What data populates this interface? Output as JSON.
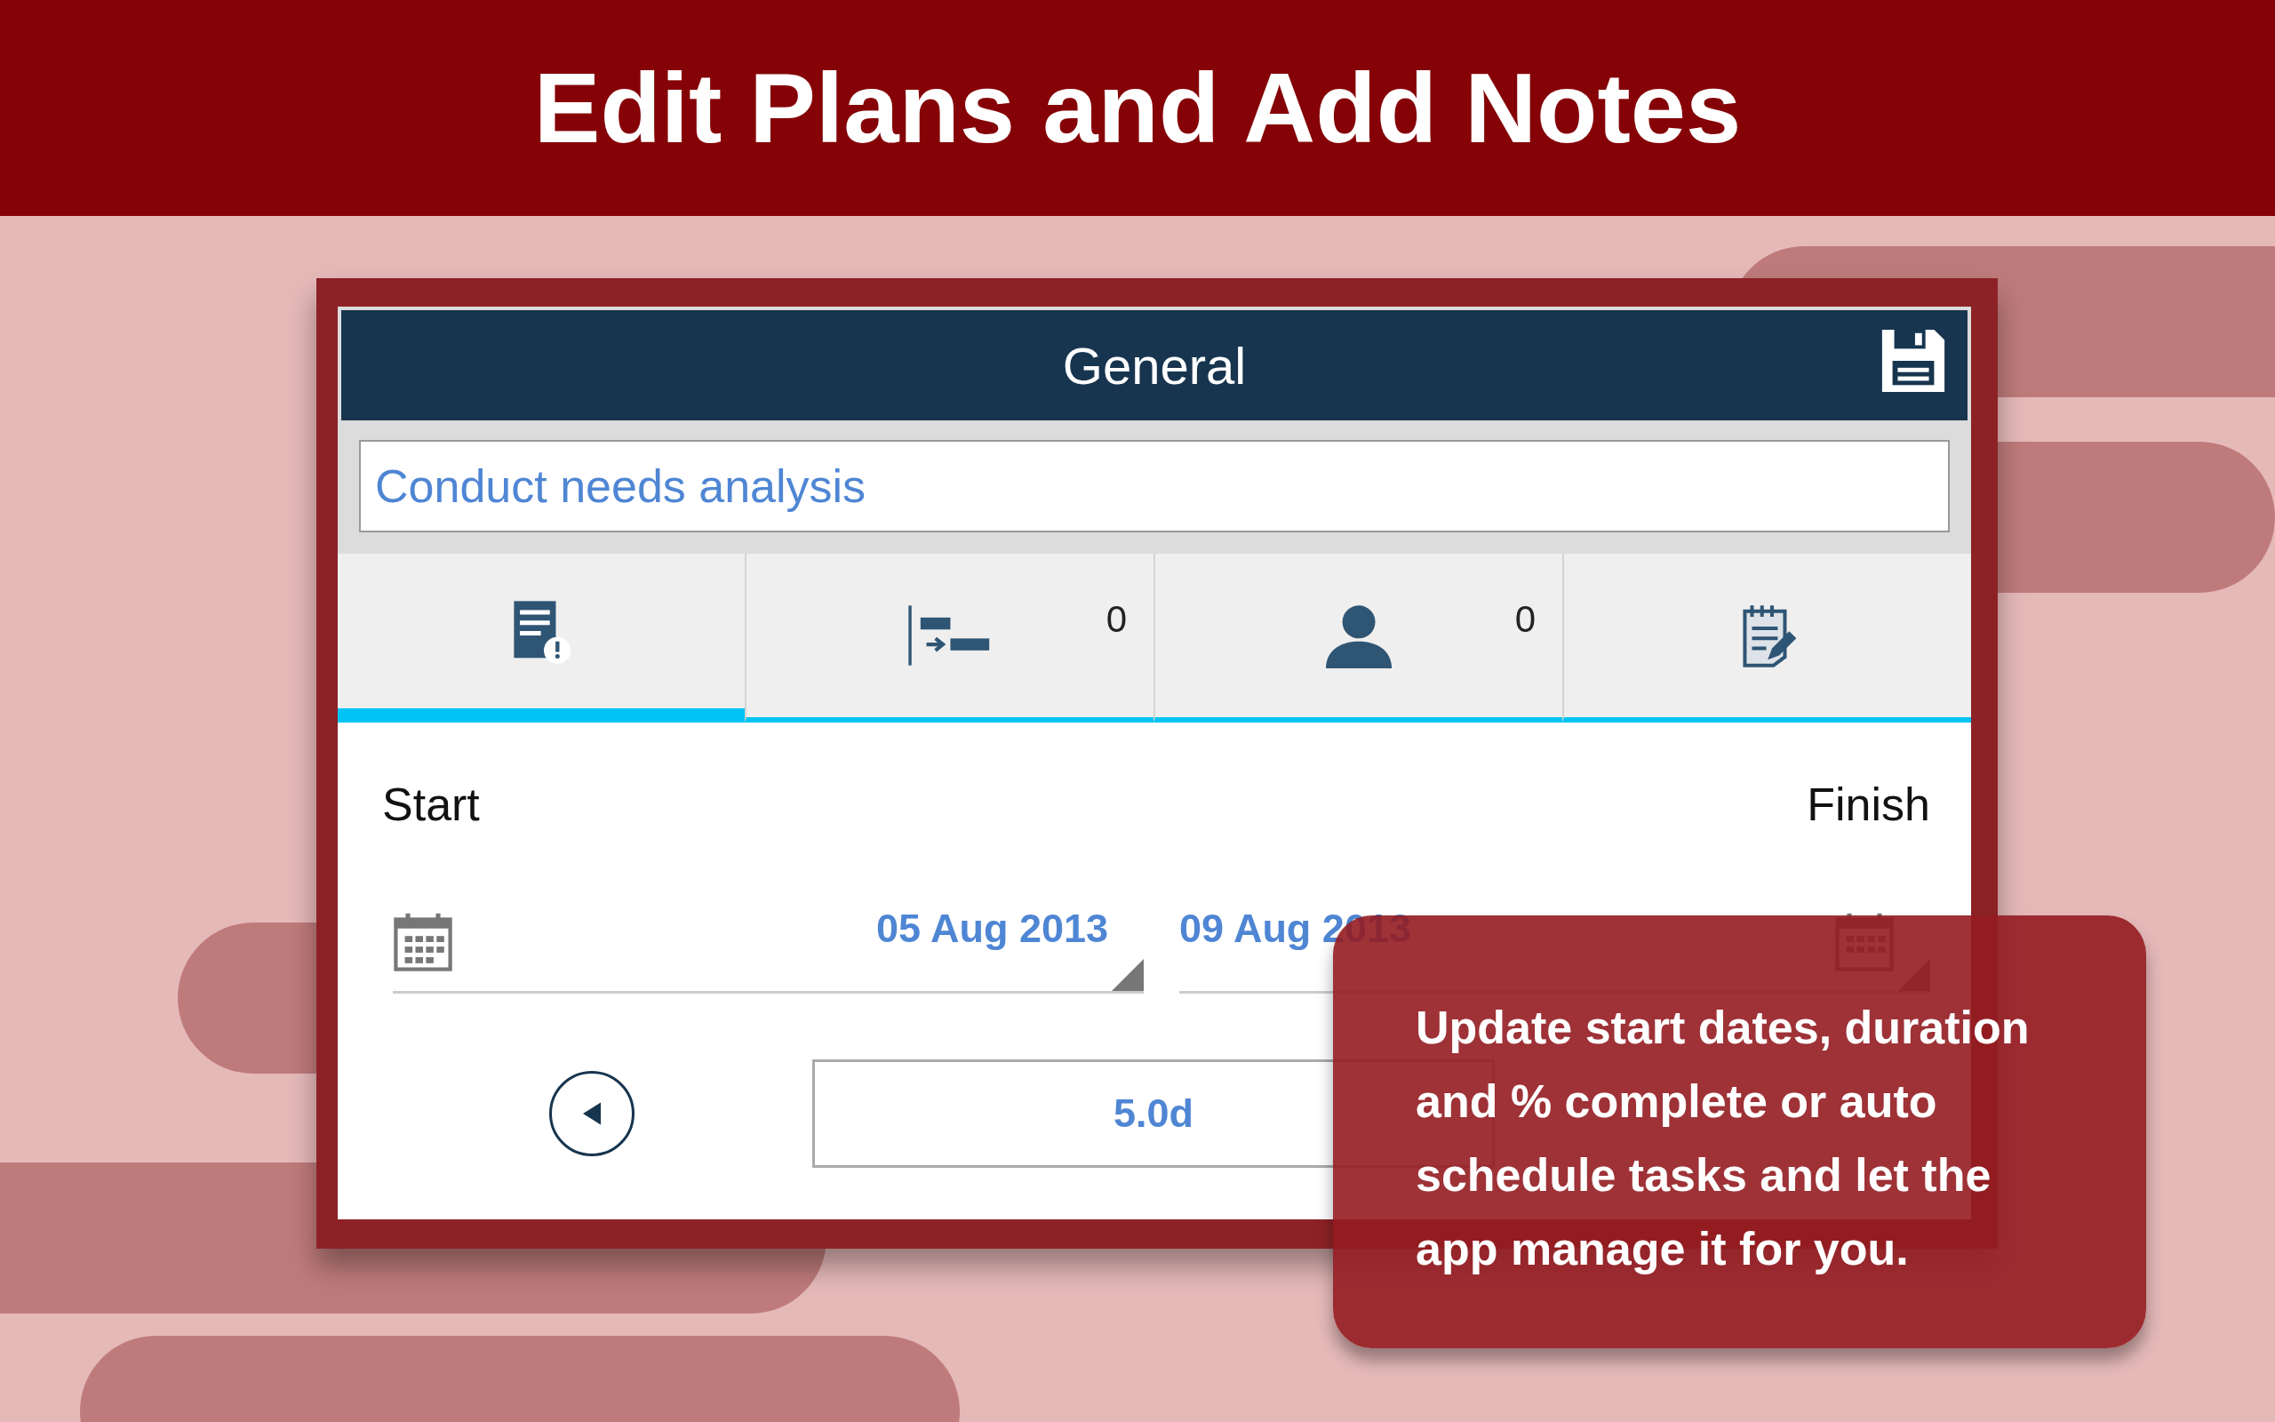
{
  "banner": {
    "title": "Edit Plans and Add Notes"
  },
  "screen": {
    "title": "General",
    "task_name": "Conduct needs analysis",
    "tabs": [
      {
        "kind": "info",
        "selected": true
      },
      {
        "kind": "gantt",
        "count": "0",
        "selected": false
      },
      {
        "kind": "person",
        "count": "0",
        "selected": false
      },
      {
        "kind": "notes",
        "selected": false
      }
    ],
    "start": {
      "label": "Start",
      "date": "05 Aug 2013"
    },
    "finish": {
      "label": "Finish",
      "date": "09 Aug 2013"
    },
    "duration": "5.0d"
  },
  "callout": {
    "lines": [
      "Update start dates, duration",
      "and % complete or auto",
      "schedule tasks and let the",
      "app manage it for you."
    ]
  }
}
